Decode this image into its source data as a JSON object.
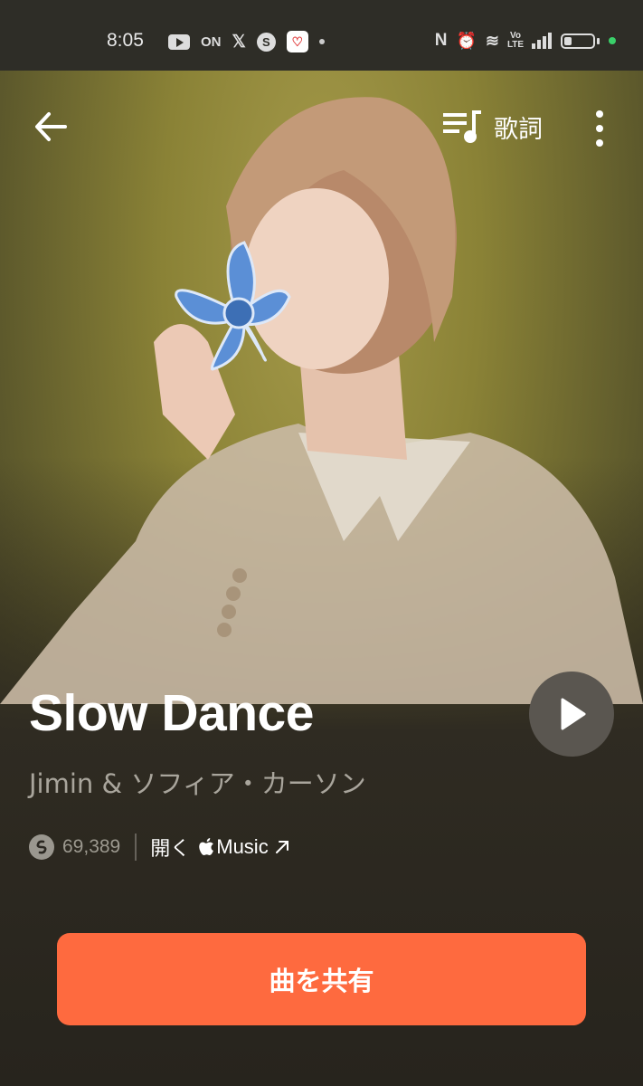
{
  "status_bar": {
    "time": "8:05",
    "left_icons": [
      "youtube-icon",
      "on-app-icon",
      "x-icon",
      "shazam-icon",
      "red-app-icon",
      "dot"
    ],
    "right_icons": [
      "nfc-icon",
      "alarm-icon",
      "wifi-icon",
      "volte-icon",
      "signal-icon",
      "battery-icon",
      "green-dot"
    ],
    "on_label": "ON",
    "x_label": "𝕏",
    "nfc_label": "N",
    "volte_label": "Vo LTE"
  },
  "header": {
    "back_icon": "arrow-left-icon",
    "lyrics_icon": "lyrics-icon",
    "lyrics_label": "歌詞",
    "more_icon": "more-vertical-icon"
  },
  "track": {
    "title": "Slow Dance",
    "artist": "Jimin & ソフィア・カーソン",
    "shazam_count": "69,389",
    "open_label": "開く",
    "music_label": "Music"
  },
  "actions": {
    "share_label": "曲を共有"
  },
  "colors": {
    "accent": "#fe6a3f",
    "background": "#27241d",
    "artwork_bg": "#8a8236"
  }
}
